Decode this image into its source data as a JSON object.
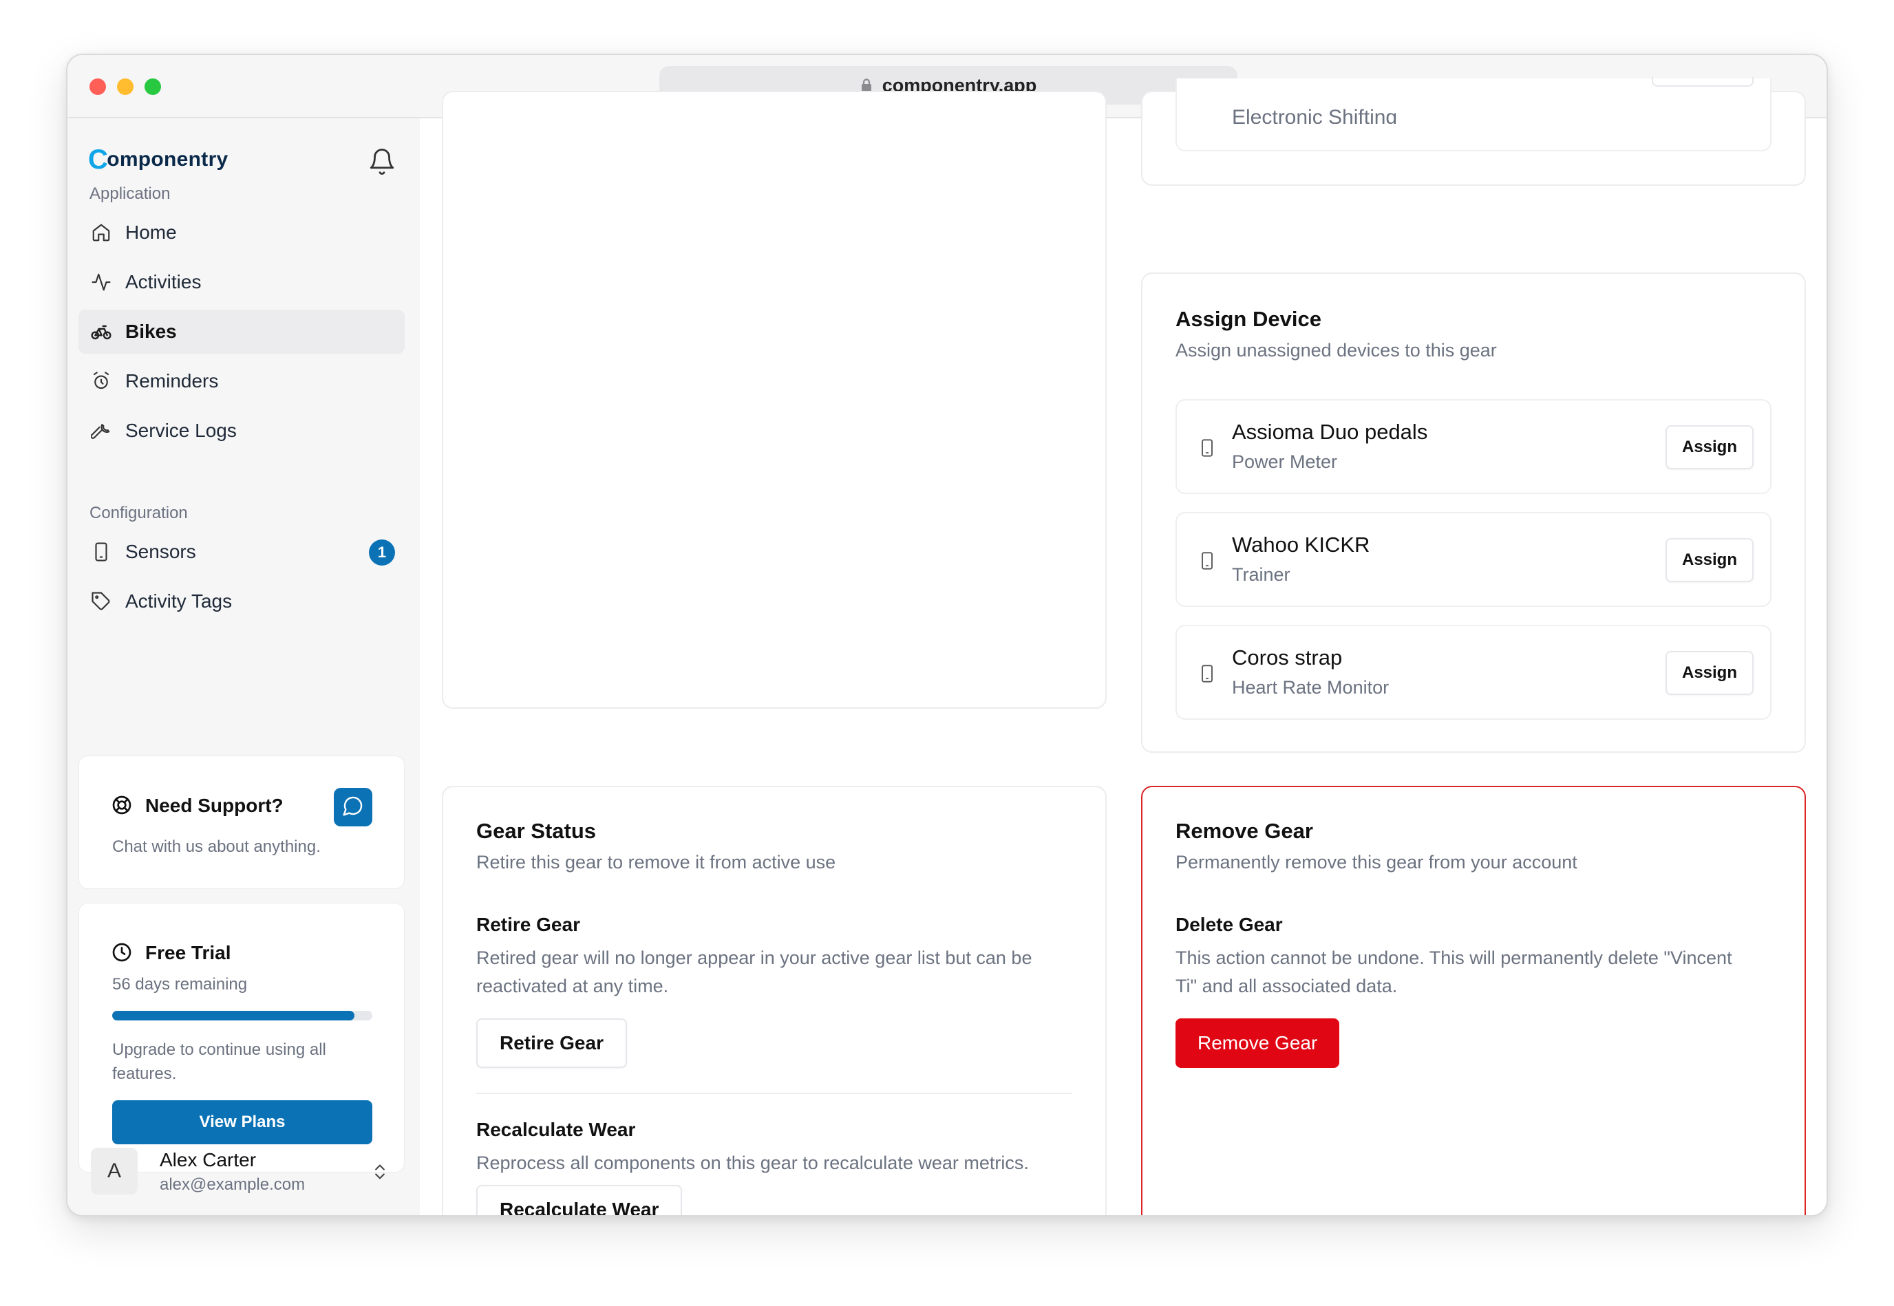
{
  "browser": {
    "url": "componentry.app"
  },
  "sidebar": {
    "brand": {
      "mark": "C",
      "name": "omponentry"
    },
    "sections": [
      {
        "label": "Application"
      },
      {
        "label": "Configuration"
      }
    ],
    "items": [
      {
        "label": "Home",
        "icon": "home-icon"
      },
      {
        "label": "Activities",
        "icon": "activity-icon"
      },
      {
        "label": "Bikes",
        "icon": "bike-icon",
        "active": true
      },
      {
        "label": "Reminders",
        "icon": "alarm-clock-icon"
      },
      {
        "label": "Service Logs",
        "icon": "wrench-icon"
      },
      {
        "label": "Sensors",
        "icon": "tablet-icon",
        "badge": "1"
      },
      {
        "label": "Activity Tags",
        "icon": "tag-icon"
      }
    ],
    "support": {
      "title": "Need Support?",
      "subtitle": "Chat with us about anything."
    },
    "trial": {
      "title": "Free Trial",
      "remaining": "56 days remaining",
      "progress_fraction": 0.93,
      "note": "Upgrade to continue using all features.",
      "button": "View Plans"
    },
    "user": {
      "initial": "A",
      "name": "Alex Carter",
      "email": "alex@example.com"
    }
  },
  "main": {
    "top_partial_text": "Electronic Shifting",
    "assign_device": {
      "title": "Assign Device",
      "subtitle": "Assign unassigned devices to this gear",
      "devices": [
        {
          "name": "Assioma Duo pedals",
          "type": "Power Meter",
          "action": "Assign"
        },
        {
          "name": "Wahoo KICKR",
          "type": "Trainer",
          "action": "Assign"
        },
        {
          "name": "Coros strap",
          "type": "Heart Rate Monitor",
          "action": "Assign"
        }
      ]
    },
    "gear_status": {
      "title": "Gear Status",
      "subtitle": "Retire this gear to remove it from active use",
      "retire": {
        "title": "Retire Gear",
        "text": "Retired gear will no longer appear in your active gear list but can be reactivated at any time.",
        "button": "Retire Gear"
      },
      "recalculate": {
        "title": "Recalculate Wear",
        "text": "Reprocess all components on this gear to recalculate wear metrics.",
        "button": "Recalculate Wear"
      }
    },
    "remove_gear": {
      "title": "Remove Gear",
      "subtitle": "Permanently remove this gear from your account",
      "delete": {
        "title": "Delete Gear",
        "text": "This action cannot be undone. This will permanently delete \"Vincent Ti\" and all associated data.",
        "button": "Remove Gear"
      },
      "accent_color": "#e10613"
    }
  }
}
